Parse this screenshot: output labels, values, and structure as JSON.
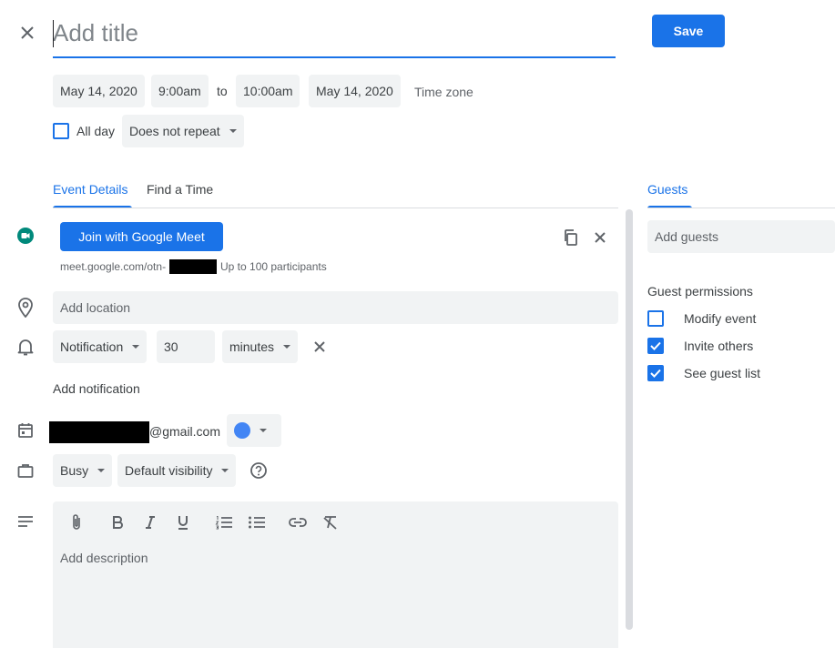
{
  "header": {
    "title_placeholder": "Add title",
    "save_label": "Save"
  },
  "datetime": {
    "start_date": "May 14, 2020",
    "start_time": "9:00am",
    "to_label": "to",
    "end_time": "10:00am",
    "end_date": "May 14, 2020",
    "timezone_label": "Time zone",
    "all_day_label": "All day",
    "repeat_value": "Does not repeat"
  },
  "tabs": {
    "details": "Event Details",
    "find_time": "Find a Time",
    "guests": "Guests"
  },
  "meet": {
    "button_label": "Join with Google Meet",
    "link_prefix": "meet.google.com/otn-",
    "participants": "Up to 100 participants"
  },
  "location": {
    "placeholder": "Add location"
  },
  "notification": {
    "type": "Notification",
    "amount": "30",
    "unit": "minutes",
    "add_label": "Add notification"
  },
  "calendar": {
    "email_suffix": "@gmail.com",
    "color": "#4285f4"
  },
  "availability": {
    "status": "Busy",
    "visibility": "Default visibility"
  },
  "description": {
    "placeholder": "Add description"
  },
  "guests_panel": {
    "add_placeholder": "Add guests",
    "permissions_title": "Guest permissions",
    "permissions": [
      {
        "label": "Modify event",
        "checked": false
      },
      {
        "label": "Invite others",
        "checked": true
      },
      {
        "label": "See guest list",
        "checked": true
      }
    ]
  },
  "colors": {
    "accent": "#1a73e8",
    "field_bg": "#f1f3f4",
    "text": "#3c4043",
    "meet_green": "#00897b"
  }
}
